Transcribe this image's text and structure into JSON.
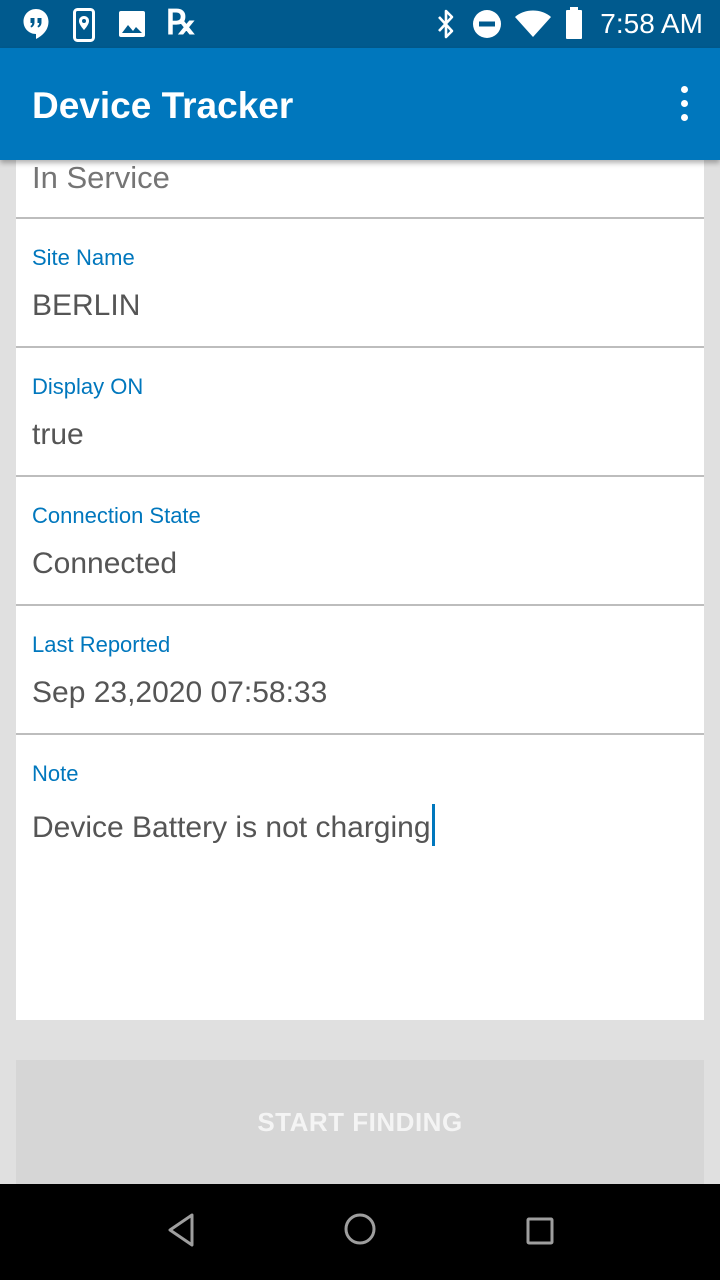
{
  "status_bar": {
    "time": "7:58 AM",
    "icons": [
      "hangouts-icon",
      "location-phone-icon",
      "image-icon",
      "rx-icon",
      "bluetooth-icon",
      "do-not-disturb-icon",
      "wifi-icon",
      "battery-icon"
    ],
    "rx_glyph": "℞"
  },
  "app_bar": {
    "title": "Device Tracker",
    "menu_icon": "more-vert-icon"
  },
  "top_partial_value": "In Service",
  "fields": [
    {
      "label": "Site Name",
      "value": "BERLIN"
    },
    {
      "label": "Display ON",
      "value": "true"
    },
    {
      "label": "Connection State",
      "value": "Connected"
    },
    {
      "label": "Last Reported",
      "value": "Sep 23,2020 07:58:33"
    },
    {
      "label": "Note",
      "value": "Device Battery is not charging"
    }
  ],
  "start_button": {
    "label": "START FINDING",
    "enabled": false
  },
  "nav_bar": {
    "icons": [
      "back-icon",
      "home-icon",
      "recents-icon"
    ]
  },
  "colors": {
    "status_bar": "#005a8e",
    "app_bar": "#0077bd",
    "label": "#0077bd",
    "background": "#e0e0e0"
  }
}
